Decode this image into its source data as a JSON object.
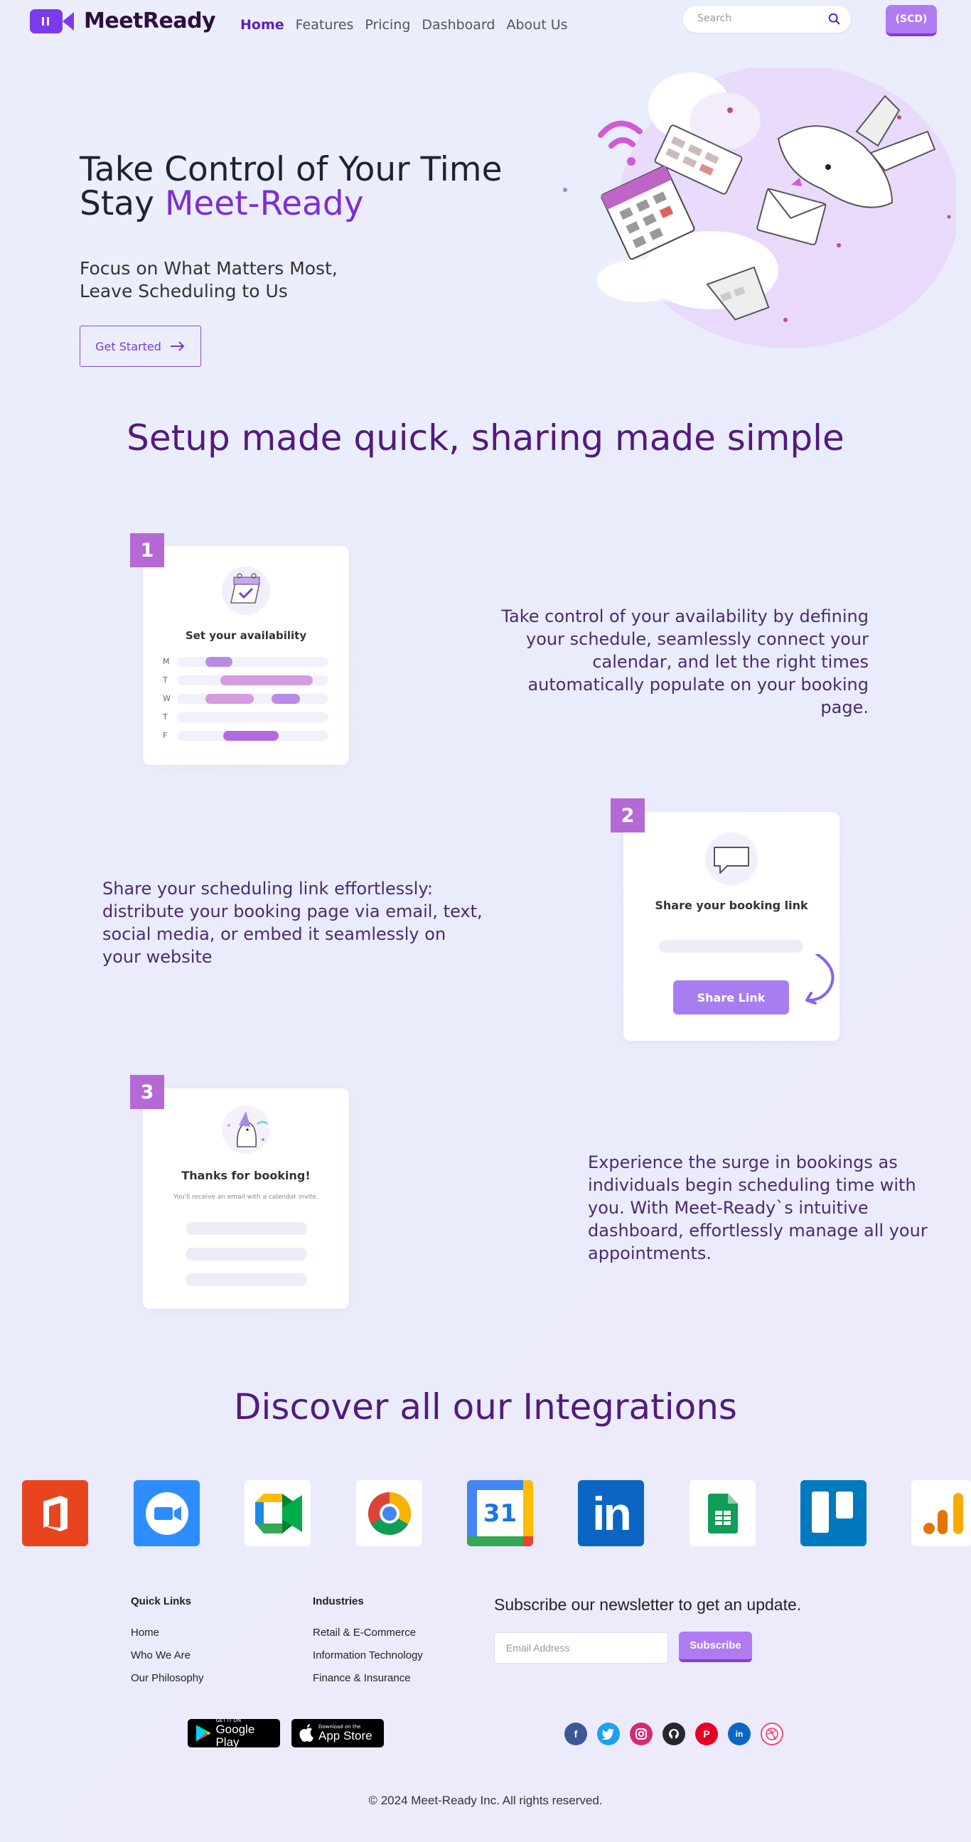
{
  "brand": {
    "name": "MeetReady",
    "accent": "#7c3aed"
  },
  "nav": {
    "links": [
      {
        "label": "Home",
        "active": true
      },
      {
        "label": "Features"
      },
      {
        "label": "Pricing"
      },
      {
        "label": "Dashboard"
      },
      {
        "label": "About Us"
      }
    ],
    "search_placeholder": "Search",
    "account_label": "(SCD)"
  },
  "hero": {
    "title_line1": "Take Control of Your Time",
    "title_line2_prefix": "Stay ",
    "title_line2_accent": "Meet-Ready",
    "subtitle_line1": "Focus on What Matters Most,",
    "subtitle_line2": "Leave Scheduling to Us",
    "cta_label": "Get Started"
  },
  "setup": {
    "title": "Setup made quick, sharing made simple",
    "steps": [
      {
        "number": "1",
        "card_title": "Set your availability",
        "days": [
          "M",
          "T",
          "W",
          "T",
          "F"
        ],
        "text": "Take control of your availability by defining your schedule, seamlessly connect your calendar, and let the right times automatically populate on your booking page."
      },
      {
        "number": "2",
        "card_title": "Share your booking link",
        "button_label": "Share Link",
        "text": "Share your scheduling link effortlessly: distribute your booking page via email, text, social media, or embed it seamlessly on your website"
      },
      {
        "number": "3",
        "card_title": "Thanks for booking!",
        "card_sub": "You'll receive an email with a calendar invite.",
        "text": "Experience the surge in bookings as individuals begin scheduling time with you. With Meet-Ready`s intuitive dashboard, effortlessly manage all your appointments."
      }
    ]
  },
  "integrations": {
    "title": "Discover all our Integrations",
    "items": [
      {
        "name": "office-icon"
      },
      {
        "name": "zoom-icon"
      },
      {
        "name": "google-meet-icon"
      },
      {
        "name": "chrome-icon"
      },
      {
        "name": "google-calendar-icon",
        "label": "31"
      },
      {
        "name": "linkedin-icon",
        "label": "in"
      },
      {
        "name": "google-sheets-icon"
      },
      {
        "name": "trello-icon"
      },
      {
        "name": "analytics-icon"
      }
    ]
  },
  "footer": {
    "quick_links": {
      "heading": "Quick Links",
      "items": [
        "Home",
        "Who We Are",
        "Our Philosophy"
      ]
    },
    "industries": {
      "heading": "Industries",
      "items": [
        "Retail & E-Commerce",
        "Information Technology",
        "Finance & Insurance"
      ]
    },
    "newsletter": {
      "title": "Subscribe our newsletter to get an update.",
      "placeholder": "Email Address",
      "button": "Subscribe"
    },
    "badges": {
      "google_small": "GET IT ON",
      "google_big": "Google Play",
      "apple_small": "Download on the",
      "apple_big": "App Store"
    },
    "socials": [
      "facebook-icon",
      "twitter-icon",
      "instagram-icon",
      "github-icon",
      "pinterest-icon",
      "linkedin-icon",
      "dribbble-icon"
    ],
    "copyright": "© 2024 Meet-Ready Inc. All rights reserved."
  }
}
